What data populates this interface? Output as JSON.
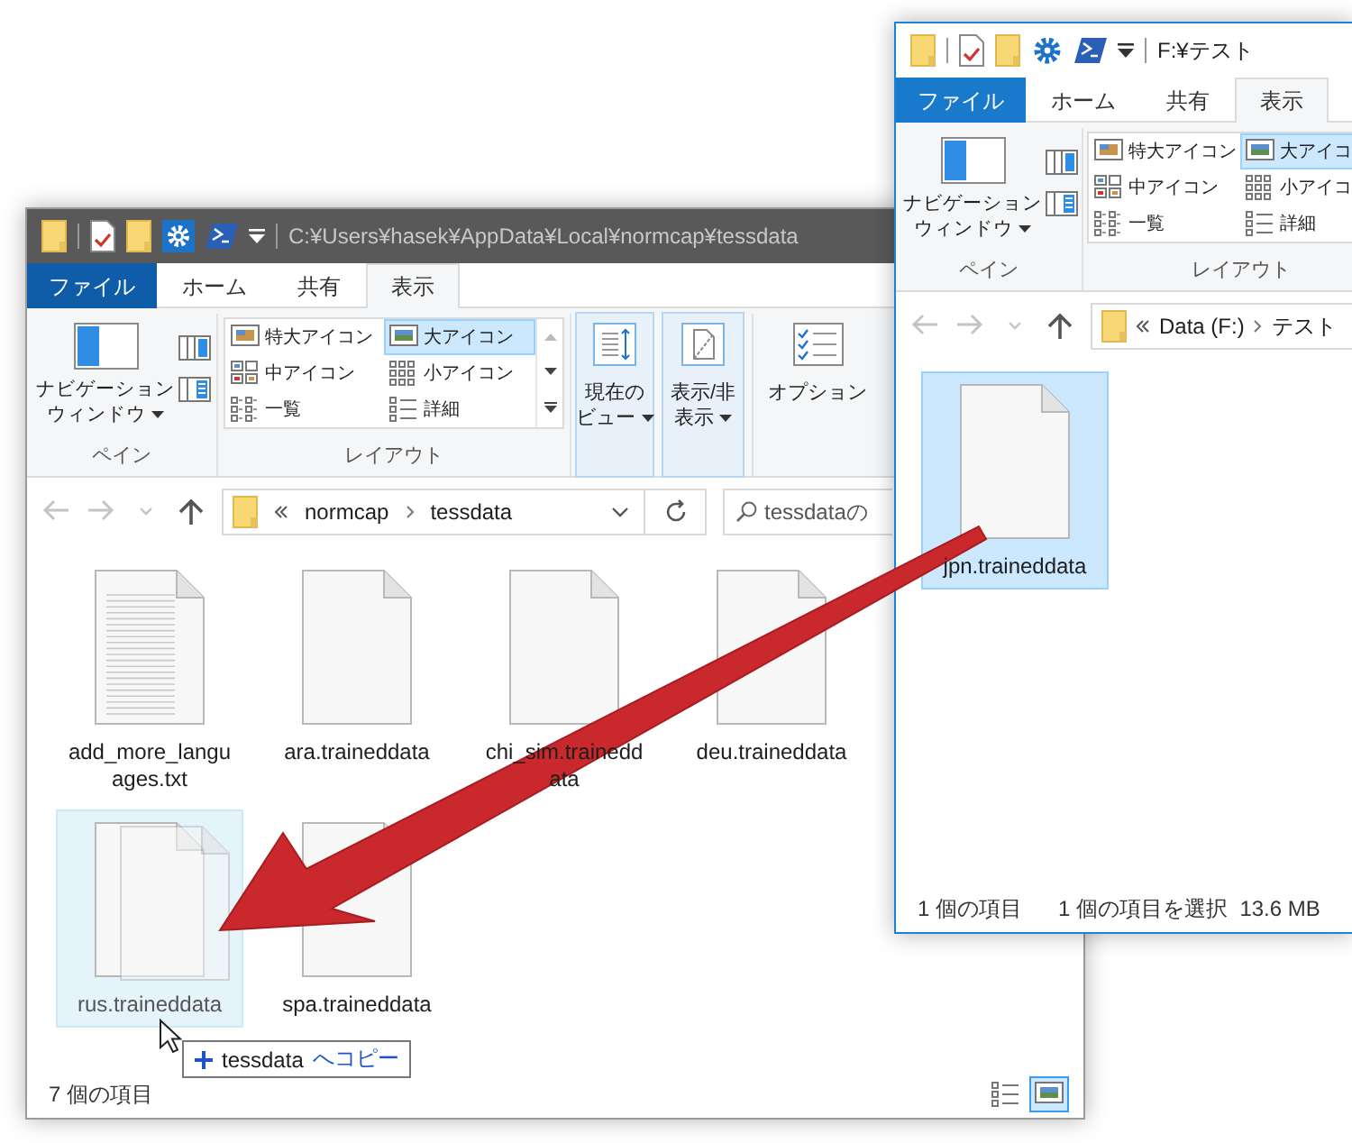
{
  "windows": [
    {
      "title": "C:¥Users¥hasek¥AppData¥Local¥normcap¥tessdata",
      "active": false,
      "ribbon_tabs": [
        {
          "label": "ファイル",
          "kind": "file",
          "selected": false
        },
        {
          "label": "ホーム",
          "kind": "tab",
          "selected": false
        },
        {
          "label": "共有",
          "kind": "tab",
          "selected": false
        },
        {
          "label": "表示",
          "kind": "tab",
          "selected": true
        }
      ],
      "pane_group": {
        "nav_pane": [
          "ナビゲーション",
          "ウィンドウ"
        ],
        "label": "ペイン"
      },
      "layout_group": {
        "label": "レイアウト",
        "options": [
          {
            "label": "特大アイコン",
            "kind": "extra-large",
            "selected": false
          },
          {
            "label": "大アイコン",
            "kind": "large",
            "selected": true
          },
          {
            "label": "中アイコン",
            "kind": "medium",
            "selected": false
          },
          {
            "label": "小アイコン",
            "kind": "small",
            "selected": false
          },
          {
            "label": "一覧",
            "kind": "list",
            "selected": false
          },
          {
            "label": "詳細",
            "kind": "details",
            "selected": false
          }
        ]
      },
      "view_buttons": [
        {
          "label": [
            "現在の",
            "ビュー"
          ],
          "kind": "current-view"
        },
        {
          "label": [
            "表示/非",
            "表示"
          ],
          "kind": "show-hide"
        },
        {
          "label": [
            "オプション"
          ],
          "kind": "options"
        }
      ],
      "breadcrumb": [
        "normcap",
        "tessdata"
      ],
      "search": {
        "placeholder": "tessdataの"
      },
      "files": [
        {
          "name": "add_more_languages.txt",
          "kind": "text",
          "selected": false,
          "drop_target": false
        },
        {
          "name": "ara.traineddata",
          "kind": "data",
          "selected": false,
          "drop_target": false
        },
        {
          "name": "chi_sim.traineddata",
          "kind": "data",
          "selected": false,
          "drop_target": false
        },
        {
          "name": "deu.traineddata",
          "kind": "data",
          "selected": false,
          "drop_target": false
        },
        {
          "name": "rus.traineddata",
          "kind": "data",
          "selected": false,
          "drop_target": true
        },
        {
          "name": "spa.traineddata",
          "kind": "data",
          "selected": false,
          "drop_target": false
        }
      ],
      "drag": {
        "target": "tessdata",
        "action": "へコピー"
      },
      "status": [
        "7 個の項目"
      ],
      "view_toggle": [
        {
          "kind": "details",
          "selected": false
        },
        {
          "kind": "large-icons",
          "selected": true
        }
      ]
    },
    {
      "title": "F:¥テスト",
      "active": true,
      "ribbon_tabs": [
        {
          "label": "ファイル",
          "kind": "file",
          "selected": false
        },
        {
          "label": "ホーム",
          "kind": "tab",
          "selected": false
        },
        {
          "label": "共有",
          "kind": "tab",
          "selected": false
        },
        {
          "label": "表示",
          "kind": "tab",
          "selected": true
        }
      ],
      "pane_group": {
        "nav_pane": [
          "ナビゲーション",
          "ウィンドウ"
        ],
        "label": "ペイン"
      },
      "layout_group": {
        "label": "レイアウト",
        "options": [
          {
            "label": "特大アイコン",
            "kind": "extra-large",
            "selected": false
          },
          {
            "label": "大アイコ",
            "kind": "large",
            "selected": true
          },
          {
            "label": "中アイコン",
            "kind": "medium",
            "selected": false
          },
          {
            "label": "小アイコ",
            "kind": "small",
            "selected": false
          },
          {
            "label": "一覧",
            "kind": "list",
            "selected": false
          },
          {
            "label": "詳細",
            "kind": "details",
            "selected": false
          }
        ]
      },
      "breadcrumb": [
        "Data (F:)",
        "テスト"
      ],
      "files": [
        {
          "name": "jpn.traineddata",
          "kind": "data",
          "selected": true,
          "drop_target": false
        }
      ],
      "status": [
        "1 個の項目",
        "1 個の項目を選択  13.6 MB"
      ]
    }
  ]
}
